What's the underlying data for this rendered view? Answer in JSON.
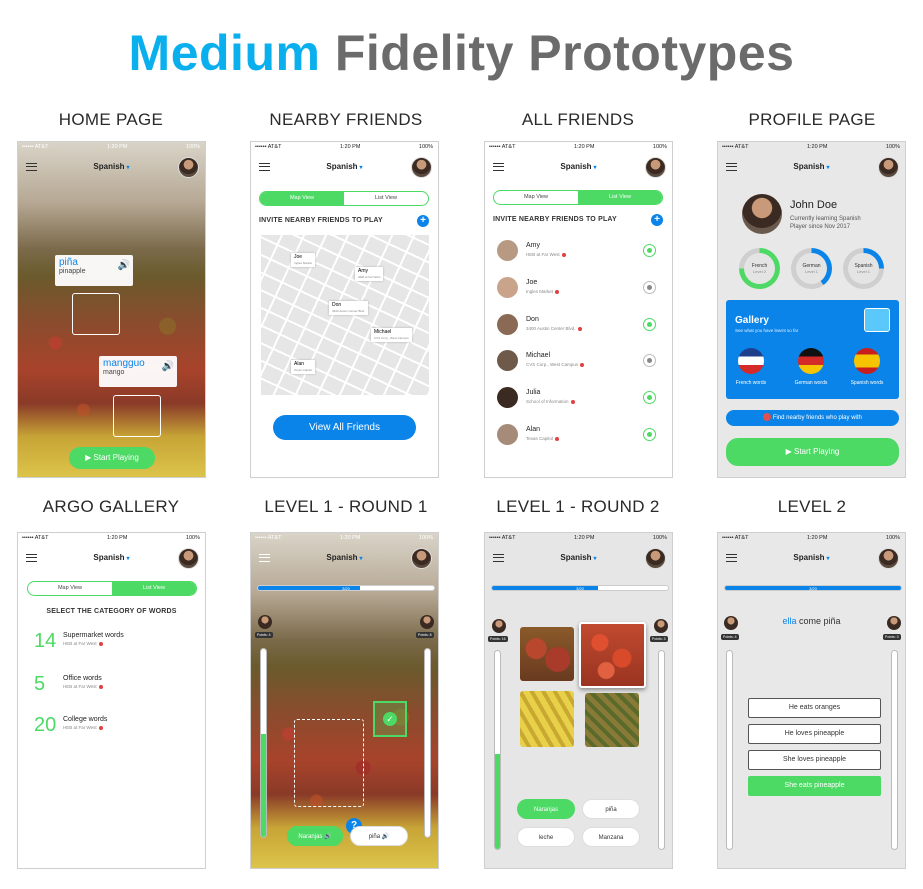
{
  "title": {
    "part1": "Medium",
    "part2": "Fidelity Prototypes"
  },
  "screens": {
    "home": "HOME PAGE",
    "nearby": "NEARBY FRIENDS",
    "all": "ALL FRIENDS",
    "profile": "PROFILE PAGE",
    "gallery": "ARGO GALLERY",
    "l1r1": "LEVEL 1 - ROUND 1",
    "l1r2": "LEVEL 1 - ROUND 2",
    "l2": "LEVEL 2"
  },
  "status": {
    "carrier": "•••••• AT&T",
    "time": "1:20 PM",
    "battery": "100%"
  },
  "nav": {
    "language": "Spanish",
    "caret": "▾"
  },
  "home": {
    "card1": {
      "word": "piña",
      "sub": "pinapple"
    },
    "card2": {
      "word": "mangguo",
      "sub": "mango"
    },
    "speaker": "🔊",
    "start": "Start Playing"
  },
  "toggle": {
    "map": "Map View",
    "list": "List View"
  },
  "nearby": {
    "heading": "INVITE NEARBY FRIENDS TO PLAY",
    "plus": "+",
    "button": "View All Friends",
    "pins": [
      {
        "name": "Joe",
        "sub": "Inglés Market"
      },
      {
        "name": "Amy",
        "sub": "HEB at Far West"
      },
      {
        "name": "Don",
        "sub": "3400 Austin Center Blvd."
      },
      {
        "name": "Michael",
        "sub": "CVS Corp., West Campus"
      },
      {
        "name": "Alan",
        "sub": "Texas Capitol"
      }
    ]
  },
  "all_friends": {
    "heading": "INVITE NEARBY FRIENDS TO PLAY",
    "plus": "+",
    "friends": [
      {
        "name": "Amy",
        "sub": "HEB at Far West"
      },
      {
        "name": "Joe",
        "sub": "Ingles Market"
      },
      {
        "name": "Don",
        "sub": "3400 Austin Center Blvd."
      },
      {
        "name": "Michael",
        "sub": "CVS Corp., West Campus"
      },
      {
        "name": "Julia",
        "sub": "School of Information"
      },
      {
        "name": "Alan",
        "sub": "Texas Capitol"
      }
    ]
  },
  "profile": {
    "name": "John Doe",
    "desc1": "Currently learning Spanish",
    "desc2": "Player since Nov 2017",
    "rings": [
      {
        "name": "French",
        "level": "Level 2"
      },
      {
        "name": "German",
        "level": "Level 1"
      },
      {
        "name": "Spanish",
        "level": "Level 1"
      }
    ],
    "gallery_title": "Gallery",
    "gallery_sub": "See what you have learnt so far",
    "flags": [
      "French words",
      "German words",
      "Spanish words"
    ],
    "find": "Find nearby friends who play with",
    "start": "Start Playing"
  },
  "argo": {
    "heading": "SELECT THE CATEGORY OF WORDS",
    "cats": [
      {
        "num": "14",
        "name": "Supermarket words",
        "sub": "HEB at Far West"
      },
      {
        "num": "5",
        "name": "Office words",
        "sub": "HEB at Far West"
      },
      {
        "num": "20",
        "name": "College words",
        "sub": "HEB at Far West"
      }
    ]
  },
  "round1": {
    "progress": "3/20",
    "points_left": "Points: 4",
    "points_right": "Points: 8",
    "answer1": "Naranjas",
    "answer2": "piña",
    "help": "?",
    "check": "✓"
  },
  "round2": {
    "progress": "3/20",
    "points_left": "Points: 16",
    "points_right": "Points: 3",
    "options": [
      "Naranjas",
      "piña",
      "leche",
      "Manzana"
    ]
  },
  "level2": {
    "progress": "3/20",
    "points_left": "Points: 4",
    "points_right": "Points: 3",
    "word1": "ella",
    "word2": "come piña",
    "options": [
      "He eats oranges",
      "He loves pineapple",
      "She loves pineapple",
      "She eats pineapple"
    ]
  },
  "colors": {
    "blue": "#0ab0ee",
    "gray": "#6b6b6b",
    "green": "#4cd964",
    "accent": "#0a84e8"
  }
}
